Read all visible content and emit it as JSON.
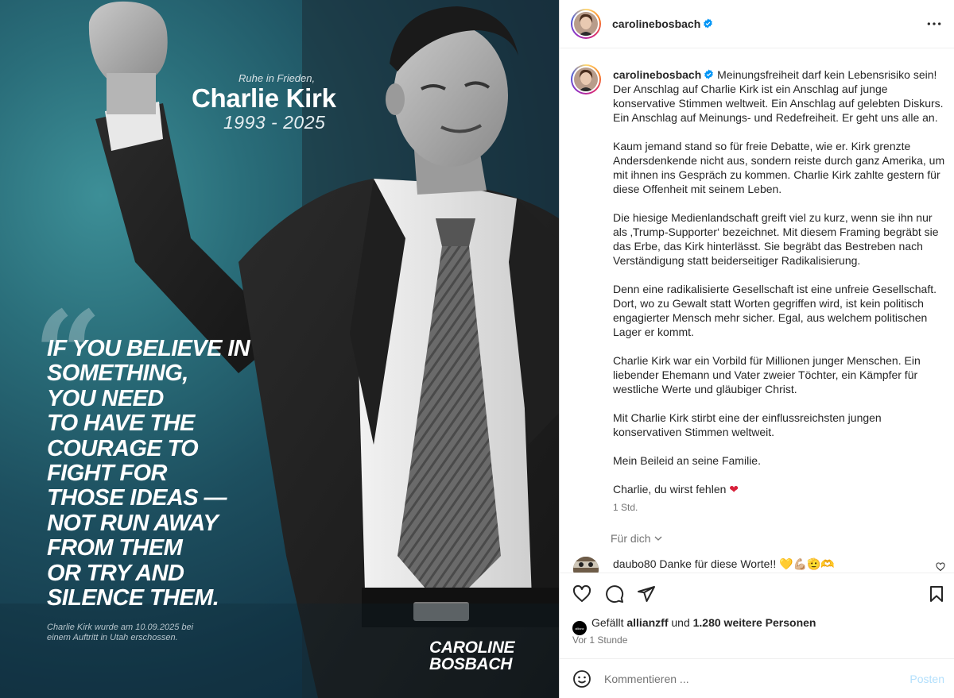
{
  "image": {
    "subtitle": "Ruhe in Frieden,",
    "name": "Charlie Kirk",
    "years": "1993 - 2025",
    "quote_lines": [
      "IF YOU BELIEVE IN",
      "SOMETHING,",
      "YOU NEED",
      "TO HAVE THE",
      "COURAGE TO",
      "FIGHT FOR",
      "THOSE IDEAS —",
      "NOT RUN AWAY",
      "FROM THEM",
      "OR TRY AND",
      "SILENCE THEM."
    ],
    "caption_line1": "Charlie Kirk wurde am 10.09.2025 bei",
    "caption_line2": "einem Auftritt in Utah erschossen.",
    "brand_line1": "CAROLINE",
    "brand_line2": "BOSBACH"
  },
  "header": {
    "username": "carolinebosbach",
    "more_icon": "more-horizontal-icon"
  },
  "caption": {
    "username": "carolinebosbach",
    "paragraphs": [
      "Meinungsfreiheit darf kein Lebensrisiko sein! Der Anschlag auf Charlie Kirk ist ein Anschlag auf junge konservative Stimmen weltweit. Ein Anschlag auf gelebten Diskurs. Ein Anschlag auf Meinungs- und Redefreiheit. Er geht uns alle an.",
      "Kaum jemand stand so für freie Debatte, wie er. Kirk grenzte Andersdenkende nicht aus, sondern reiste durch ganz Amerika, um mit ihnen ins Gespräch zu kommen. Charlie Kirk zahlte gestern für diese Offenheit mit seinem Leben.",
      "Die hiesige Medienlandschaft greift viel zu kurz, wenn sie ihn nur als ‚Trump-Supporter‘ bezeichnet. Mit diesem Framing begräbt sie das Erbe, das Kirk hinterlässt. Sie begräbt das Bestreben nach Verständigung statt beiderseitiger Radikalisierung.",
      "Denn eine radikalisierte Gesellschaft ist eine unfreie Gesellschaft. Dort, wo zu Gewalt statt Worten gegriffen wird, ist kein politisch engagierter Mensch mehr sicher. Egal, aus welchem politischen Lager er kommt.",
      "Charlie Kirk war ein Vorbild für Millionen junger Menschen. Ein liebender Ehemann und Vater zweier Töchter, ein Kämpfer für westliche Werte und gläubiger Christ.",
      "Mit Charlie Kirk stirbt eine der einflussreichsten jungen konservativen Stimmen weltweit.",
      "Mein Beileid an seine Familie.",
      "Charlie, du wirst fehlen"
    ],
    "heart": "❤",
    "time": "1 Std.",
    "for_you": "Für dich"
  },
  "comment": {
    "username": "daubo80",
    "text": "Danke für diese Worte!! 💛💪🏼🫡🫶"
  },
  "likes": {
    "liker_avatar_text": "allianz",
    "prefix": "Gefällt",
    "user": "allianzff",
    "middle": "und",
    "count": "1.280 weitere Personen",
    "time": "Vor 1 Stunde"
  },
  "add_comment": {
    "placeholder": "Kommentieren ...",
    "post_label": "Posten"
  },
  "colors": {
    "verified": "#0095f6",
    "muted": "#737373",
    "post_disabled": "#b2dffc",
    "heart": "#d8203a"
  }
}
